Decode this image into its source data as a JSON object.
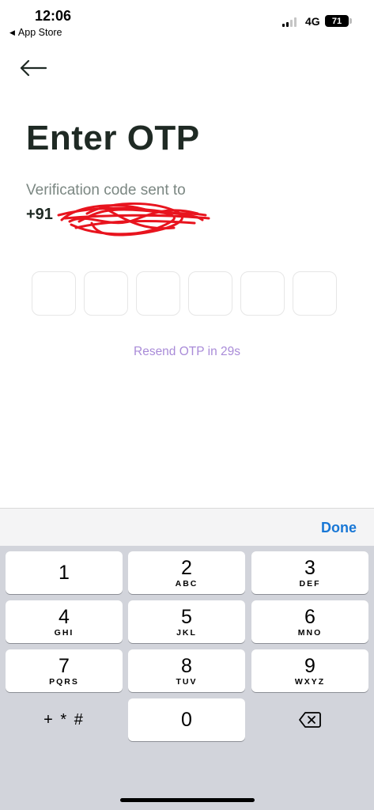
{
  "status_bar": {
    "time": "12:06",
    "back_app": "App Store",
    "network": "4G",
    "battery": "71"
  },
  "header": {
    "back_icon": "arrow-left-icon"
  },
  "main": {
    "title": "Enter OTP",
    "subtitle": "Verification code sent to",
    "phone_prefix": "+91",
    "phone_redaction": "red scribble redaction",
    "otp_boxes": [
      "",
      "",
      "",
      "",
      "",
      ""
    ],
    "resend_text": "Resend OTP in 29s"
  },
  "keyboard": {
    "done_label": "Done",
    "keys": [
      {
        "num": "1",
        "letters": ""
      },
      {
        "num": "2",
        "letters": "ABC"
      },
      {
        "num": "3",
        "letters": "DEF"
      },
      {
        "num": "4",
        "letters": "GHI"
      },
      {
        "num": "5",
        "letters": "JKL"
      },
      {
        "num": "6",
        "letters": "MNO"
      },
      {
        "num": "7",
        "letters": "PQRS"
      },
      {
        "num": "8",
        "letters": "TUV"
      },
      {
        "num": "9",
        "letters": "WXYZ"
      },
      {
        "num": "0",
        "letters": ""
      }
    ],
    "symbols_label": "+ * #",
    "delete_icon": "backspace-icon"
  },
  "colors": {
    "accent": "#1877d6",
    "resend": "#a98bd8",
    "title": "#1f2a24",
    "redaction": "#e8141e"
  }
}
